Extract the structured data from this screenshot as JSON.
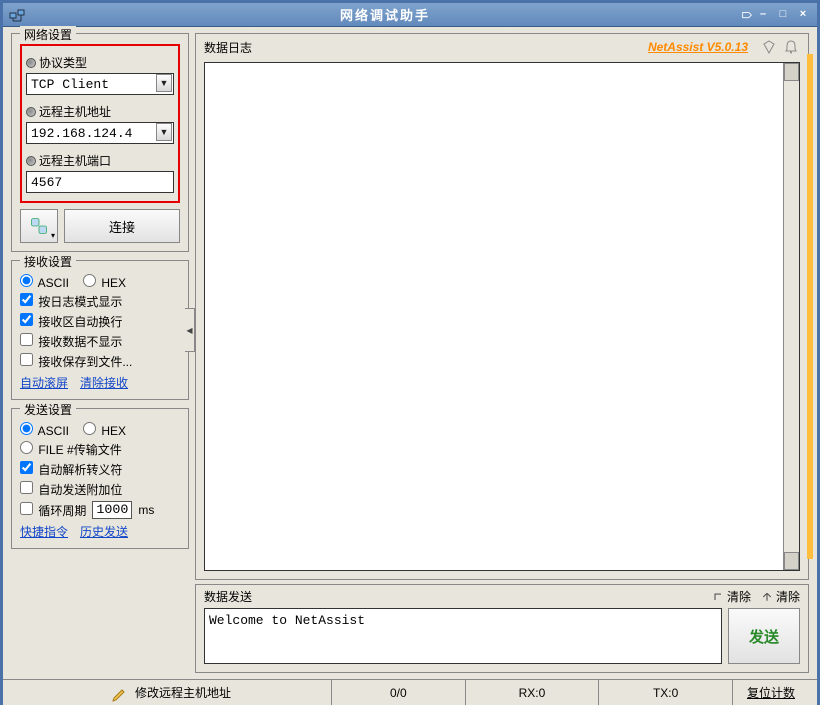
{
  "window": {
    "title": "网络调试助手",
    "minimize": "–",
    "maximize": "□",
    "close": "×"
  },
  "version_link": "NetAssist V5.0.13",
  "network_settings": {
    "group_title": "网络设置",
    "protocol_label": "协议类型",
    "protocol_value": "TCP Client",
    "remote_host_label": "远程主机地址",
    "remote_host_value": "192.168.124.4",
    "remote_port_label": "远程主机端口",
    "remote_port_value": "4567",
    "connect_label": "连接"
  },
  "recv_settings": {
    "group_title": "接收设置",
    "radio_ascii": "ASCII",
    "radio_hex": "HEX",
    "chk_log_mode": "按日志模式显示",
    "chk_auto_wrap": "接收区自动换行",
    "chk_no_display": "接收数据不显示",
    "chk_save_file": "接收保存到文件...",
    "link_autoscroll": "自动滚屏",
    "link_clear_recv": "清除接收"
  },
  "send_settings": {
    "group_title": "发送设置",
    "radio_ascii": "ASCII",
    "radio_hex": "HEX",
    "radio_file": "FILE #传输文件",
    "chk_auto_parse": "自动解析转义符",
    "chk_auto_append": "自动发送附加位",
    "chk_loop": "循环周期",
    "loop_value": "1000",
    "loop_unit": "ms",
    "link_quick": "快捷指令",
    "link_history": "历史发送"
  },
  "data_log": {
    "label": "数据日志"
  },
  "data_send": {
    "label": "数据发送",
    "clear1": "清除",
    "clear2": "清除",
    "content": "Welcome to NetAssist",
    "send_btn": "发送"
  },
  "status": {
    "message": "修改远程主机地址",
    "frames": "0/0",
    "rx": "RX:0",
    "tx": "TX:0",
    "reset": "复位计数"
  }
}
